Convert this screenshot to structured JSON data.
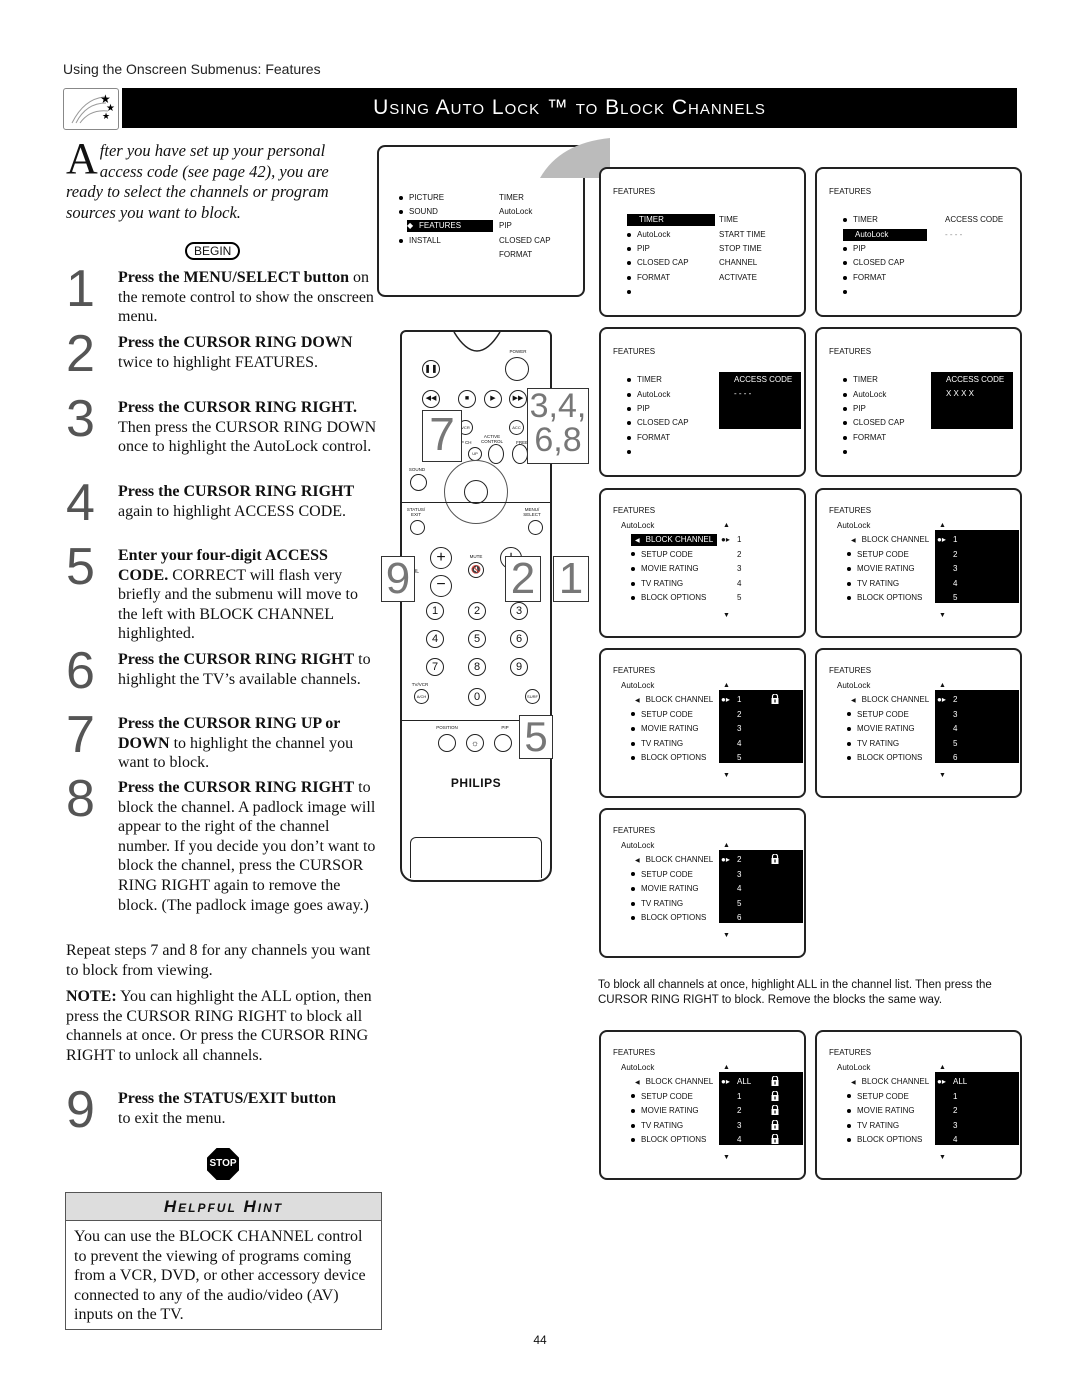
{
  "header": {
    "section_label": "Using the Onscreen Submenus: Features",
    "banner_title": "Using Auto Lock ™ to Block Channels",
    "banner_icon": "shooting-stars-icon"
  },
  "intro": {
    "drop_cap": "A",
    "text": "fter you have set up your personal access code (see page 42), you are ready to select the channels or program sources you want to block.",
    "begin_label": "BEGIN"
  },
  "steps": [
    {
      "num": "1",
      "bold": "Press the MENU/SELECT button",
      "rest": " on the remote control to show the onscreen menu."
    },
    {
      "num": "2",
      "bold": "Press the CURSOR RING DOWN",
      "rest": " twice to highlight FEATURES."
    },
    {
      "num": "3",
      "bold": "Press the CURSOR RING RIGHT.",
      "rest": " Then press the CURSOR RING DOWN once to highlight the AutoLock control."
    },
    {
      "num": "4",
      "bold": "Press the CURSOR RING RIGHT",
      "rest": " again to highlight ACCESS CODE."
    },
    {
      "num": "5",
      "bold": "Enter your four-digit ACCESS CODE.",
      "rest": " CORRECT will flash very briefly and the submenu will move to the left with BLOCK CHANNEL highlighted."
    },
    {
      "num": "6",
      "bold": "Press the CURSOR RING RIGHT",
      "rest": " to highlight the TV’s available channels."
    },
    {
      "num": "7",
      "bold": "Press the CURSOR RING UP or DOWN",
      "rest": " to highlight the channel you want to block."
    },
    {
      "num": "8",
      "bold": "Press the CURSOR RING RIGHT",
      "rest": " to block the channel. A padlock image will appear to the right of the channel number. If you decide you don’t want to block the channel, press the CURSOR RING RIGHT again to remove the block. (The padlock image goes away.)"
    },
    {
      "num": "9",
      "bold": "Press the STATUS/EXIT button",
      "rest": " to exit the menu."
    }
  ],
  "repeat_note": "Repeat steps 7 and 8 for any channels you want to block from viewing.",
  "note": {
    "label": "NOTE:",
    "text": " You can highlight the ALL option, then press the CURSOR RING RIGHT to block all channels at once. Or press the CURSOR RING RIGHT to unlock all channels."
  },
  "stop_label": "STOP",
  "hint": {
    "title": "Helpful Hint",
    "text": "You can use the BLOCK CHANNEL control to prevent the viewing of programs coming from a VCR, DVD, or other accessory device connected to any of the audio/video (AV) inputs on the TV."
  },
  "main_menu": {
    "left": [
      "PICTURE",
      "SOUND",
      "FEATURES",
      "INSTALL"
    ],
    "right": [
      "TIMER",
      "AutoLock",
      "PIP",
      "CLOSED CAP",
      "FORMAT"
    ],
    "selected": "FEATURES"
  },
  "features_screens": {
    "title": "FEATURES",
    "items": [
      "TIMER",
      "AutoLock",
      "PIP",
      "CLOSED CAP",
      "FORMAT"
    ],
    "timer_sub": [
      "TIME",
      "START TIME",
      "STOP TIME",
      "CHANNEL",
      "ACTIVATE"
    ],
    "access_code_label": "ACCESS CODE",
    "access_code_empty": "- - - -",
    "access_code_entered": "X X X X"
  },
  "autolock_screens": {
    "title": "FEATURES",
    "subtitle": "AutoLock",
    "items": [
      "BLOCK CHANNEL",
      "SETUP CODE",
      "MOVIE RATING",
      "TV RATING",
      "BLOCK OPTIONS"
    ],
    "lists": {
      "a": [
        "1",
        "2",
        "3",
        "4",
        "5"
      ],
      "b": [
        "1",
        "2",
        "3",
        "4",
        "5"
      ],
      "c": [
        "1",
        "2",
        "3",
        "4",
        "5"
      ],
      "d": [
        "2",
        "3",
        "4",
        "5",
        "6"
      ],
      "e": [
        "2",
        "3",
        "4",
        "5",
        "6"
      ],
      "f": [
        "ALL",
        "1",
        "2",
        "3",
        "4"
      ],
      "g": [
        "ALL",
        "1",
        "2",
        "3",
        "4"
      ]
    }
  },
  "caption": "To block all channels at once, highlight ALL in the channel list. Then press the CURSOR RING RIGHT to block. Remove the blocks the same way.",
  "remote": {
    "brand": "PHILIPS",
    "labels": {
      "power": "POWER",
      "vcr": "VCR",
      "acc": "ACC",
      "pipch": "PIP CH",
      "active": "ACTIVE CONTROL",
      "freeze": "FREEZE",
      "up": "UP",
      "sound": "SOUND",
      "status": "STATUS/ EXIT",
      "menu": "MENU/ SELECT",
      "mute": "MUTE",
      "vol": "VOL",
      "tvvcr": "TV/VCR",
      "ach": "A/CH",
      "surf": "SURF",
      "position": "POSITION",
      "pip": "PIP"
    },
    "keys": [
      "1",
      "2",
      "3",
      "4",
      "5",
      "6",
      "7",
      "8",
      "9",
      "0"
    ],
    "callouts": {
      "c7": "7",
      "c3468": "3,4, 6,8",
      "c9": "9",
      "c2": "2",
      "c1": "1",
      "c5": "5"
    }
  },
  "page_number": "44"
}
